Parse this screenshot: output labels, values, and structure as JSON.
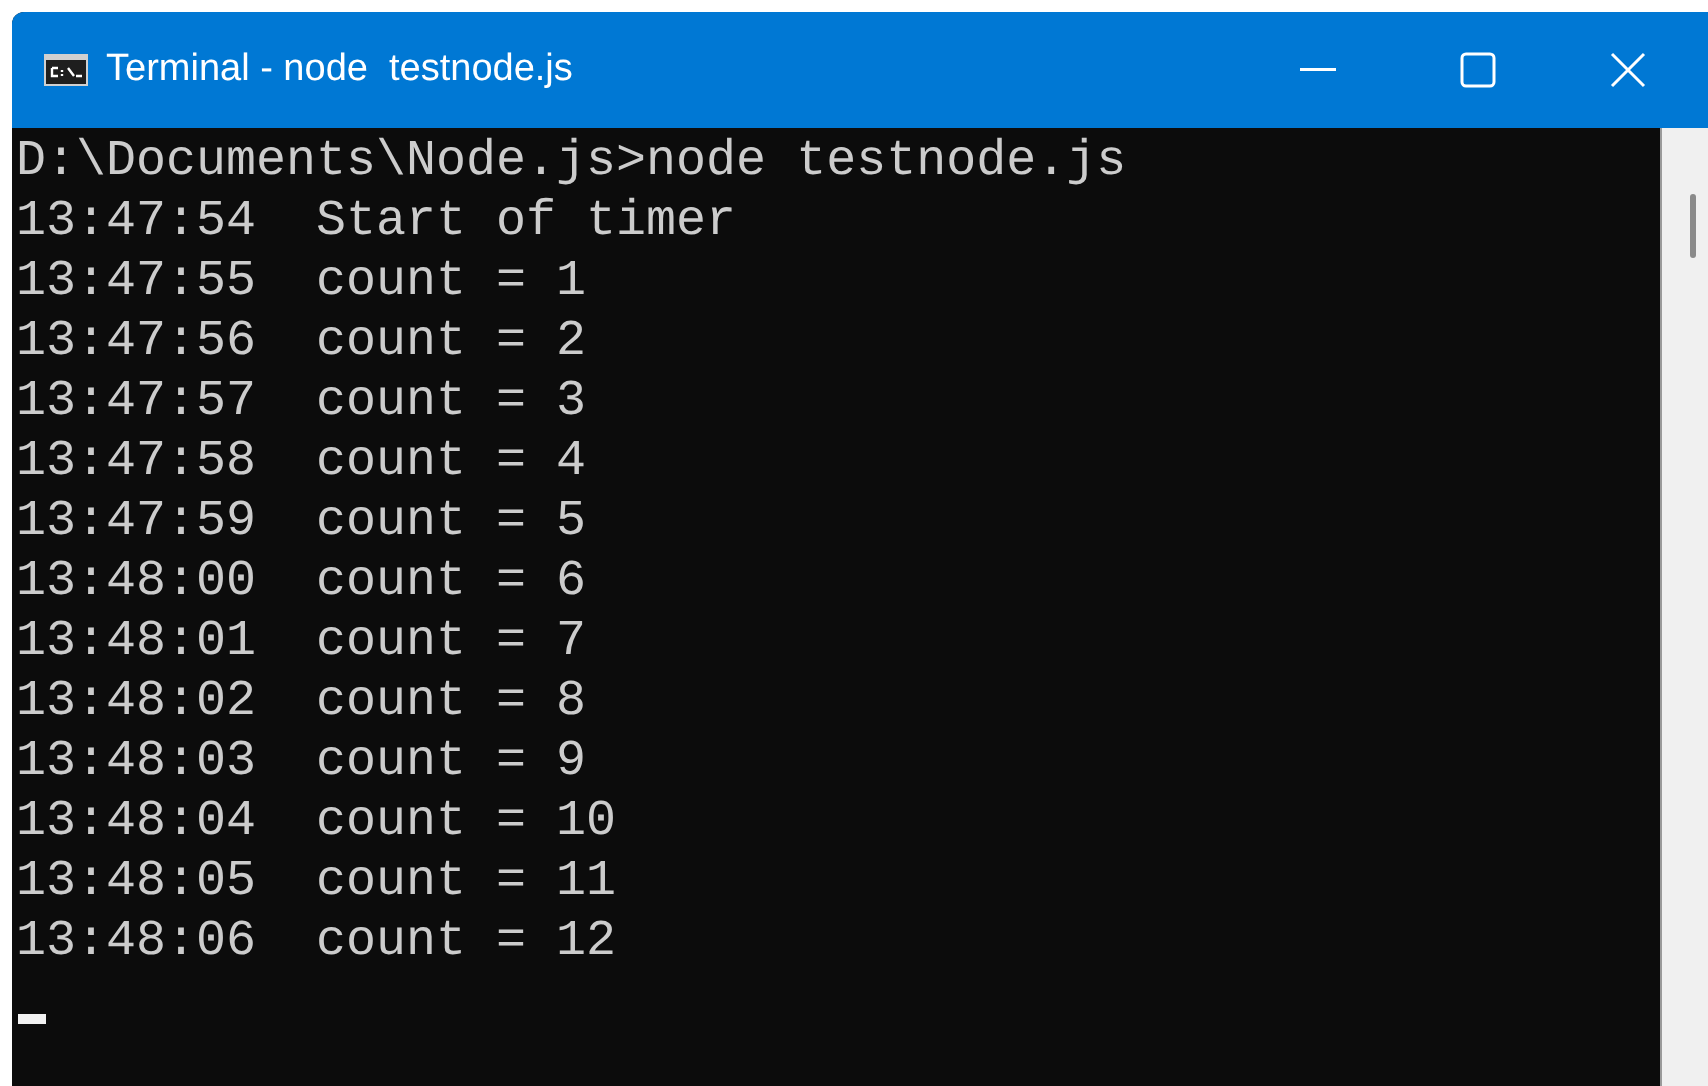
{
  "window": {
    "title": "Terminal - node  testnode.js"
  },
  "terminal": {
    "lines": [
      "D:\\Documents\\Node.js>node testnode.js",
      "13:47:54  Start of timer",
      "13:47:55  count = 1",
      "13:47:56  count = 2",
      "13:47:57  count = 3",
      "13:47:58  count = 4",
      "13:47:59  count = 5",
      "13:48:00  count = 6",
      "13:48:01  count = 7",
      "13:48:02  count = 8",
      "13:48:03  count = 9",
      "13:48:04  count = 10",
      "13:48:05  count = 11",
      "13:48:06  count = 12"
    ],
    "cursor_visible": true
  }
}
